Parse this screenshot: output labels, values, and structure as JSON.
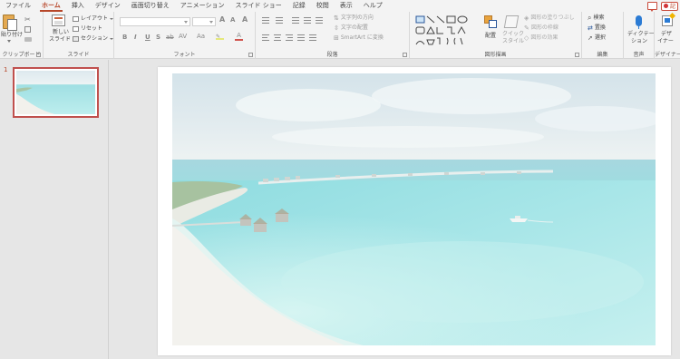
{
  "tabs": [
    "ファイル",
    "ホーム",
    "挿入",
    "デザイン",
    "画面切り替え",
    "アニメーション",
    "スライド ショー",
    "記録",
    "校閲",
    "表示",
    "ヘルプ"
  ],
  "active_tab": "ホーム",
  "title_bar": {
    "record_label": "記"
  },
  "ribbon": {
    "clipboard": {
      "paste_label": "貼り付け",
      "group_label": "クリップボード"
    },
    "slides": {
      "new_slide_line1": "新しい",
      "new_slide_line2": "スライド",
      "layout_label": "レイアウト",
      "reset_label": "リセット",
      "section_label": "セクション",
      "group_label": "スライド"
    },
    "font": {
      "bold": "B",
      "italic": "I",
      "underline": "U",
      "strike": "S",
      "shadow": "ab",
      "spacing": "AV",
      "case": "Aa",
      "grow": "A",
      "shrink": "A",
      "clear": "A",
      "group_label": "フォント"
    },
    "paragraph": {
      "text_direction": "文字列の方向",
      "align_text": "文字の配置",
      "smartart": "SmartArt に変換",
      "group_label": "段落"
    },
    "drawing": {
      "arrange_label": "配置",
      "quick_styles_line1": "クイック",
      "quick_styles_line2": "スタイル",
      "shape_fill": "図形の塗りつぶし",
      "shape_outline": "図形の枠線",
      "shape_effects": "図形の効果",
      "group_label": "図形描画"
    },
    "editing": {
      "find": "検索",
      "replace": "置換",
      "select": "選択",
      "group_label": "編集"
    },
    "voice": {
      "dictate_line1": "ディクテー",
      "dictate_line2": "ション",
      "group_label": "音声"
    },
    "designer": {
      "designer_line1": "デザ",
      "designer_line2": "イナー",
      "group_label": "デザイナー"
    }
  },
  "thumbnails": [
    {
      "number": "1"
    }
  ],
  "colors": {
    "accent": "#b7472a",
    "selection_border": "#c0504d",
    "ribbon_bg": "#f3f3f3",
    "workspace_bg": "#e6e6e6",
    "sea_light": "#bfeef0",
    "sea_deep": "#8fdbe0"
  }
}
